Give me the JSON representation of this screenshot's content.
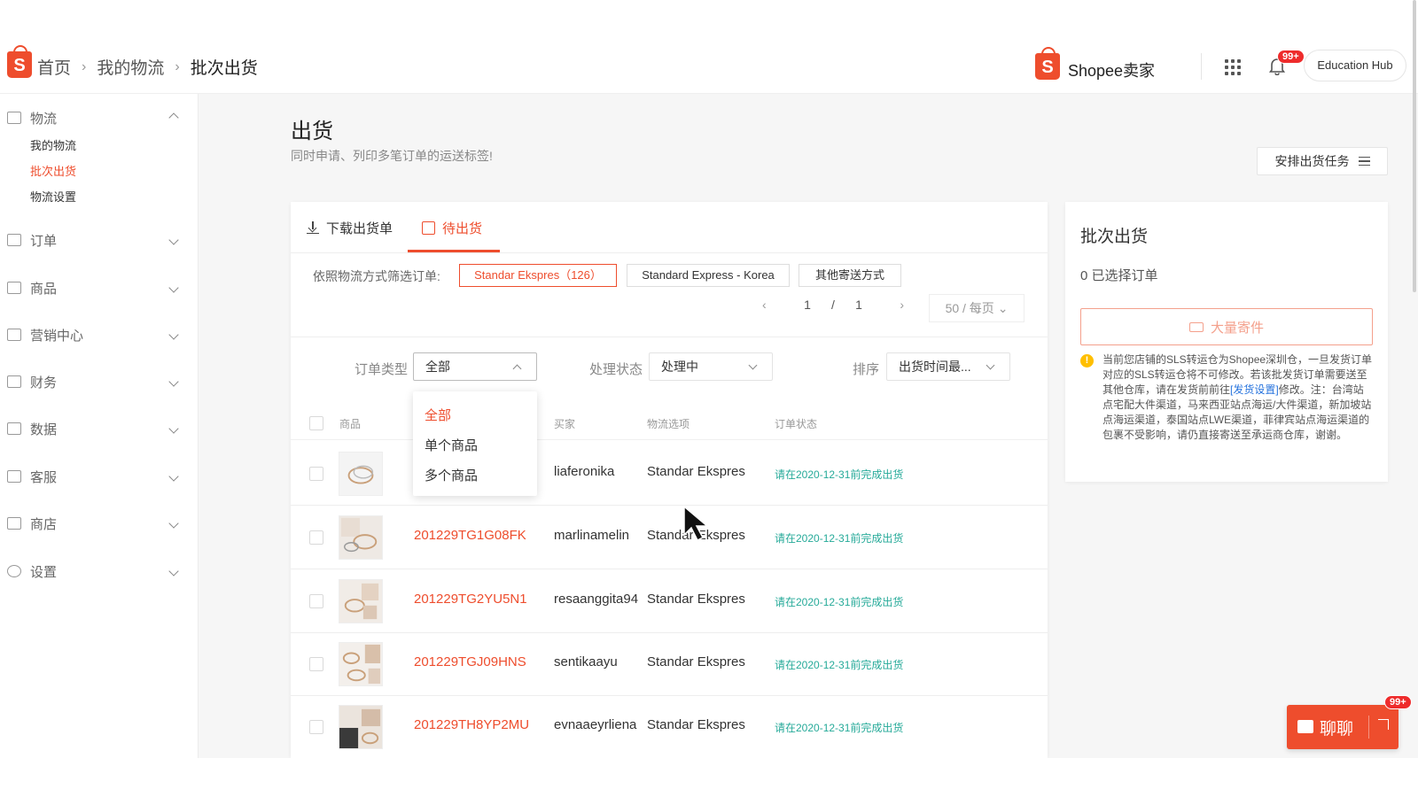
{
  "header": {
    "breadcrumb": [
      "首页",
      "我的物流",
      "批次出货"
    ],
    "brand": "Shopee卖家",
    "notifications_badge": "99+",
    "education_hub": "Education Hub"
  },
  "sidebar": {
    "groups": [
      {
        "label": "物流",
        "icon": "truck-icon",
        "expanded": true,
        "items": [
          "我的物流",
          "批次出货",
          "物流设置"
        ],
        "active_item": "批次出货"
      },
      {
        "label": "订单",
        "icon": "clipboard-icon"
      },
      {
        "label": "商品",
        "icon": "box-icon"
      },
      {
        "label": "营销中心",
        "icon": "tag-icon"
      },
      {
        "label": "财务",
        "icon": "wallet-icon"
      },
      {
        "label": "数据",
        "icon": "chart-icon"
      },
      {
        "label": "客服",
        "icon": "chat-icon"
      },
      {
        "label": "商店",
        "icon": "shop-icon"
      },
      {
        "label": "设置",
        "icon": "gear-icon"
      }
    ]
  },
  "page": {
    "title": "出货",
    "subtitle": "同时申请、列印多笔订单的运送标签!",
    "arrange_button": "安排出货任务"
  },
  "tabs": [
    {
      "label": "下载出货单",
      "icon": "download-icon"
    },
    {
      "label": "待出货",
      "icon": "package-icon",
      "active": true
    }
  ],
  "filter": {
    "label": "依照物流方式筛选订单:",
    "chips": [
      "Standar Ekspres（126）",
      "Standard Express - Korea",
      "其他寄送方式"
    ],
    "active_chip": 0
  },
  "pagination": {
    "current": "1",
    "separator": "/",
    "total": "1",
    "per_page": "50 / 每页"
  },
  "filters": {
    "order_type": {
      "label": "订单类型",
      "value": "全部",
      "options": [
        "全部",
        "单个商品",
        "多个商品"
      ]
    },
    "process_status": {
      "label": "处理状态",
      "value": "处理中"
    },
    "sort": {
      "label": "排序",
      "value": "出货时间最..."
    }
  },
  "table": {
    "headers": [
      "商品",
      "买家",
      "物流选项",
      "订单状态"
    ],
    "rows": [
      {
        "order_id": "",
        "buyer": "liaferonika",
        "shipping": "Standar Ekspres",
        "status": "请在2020-12-31前完成出货"
      },
      {
        "order_id": "201229TG1G08FK",
        "buyer": "marlinamelin",
        "shipping": "Standar Ekspres",
        "status": "请在2020-12-31前完成出货"
      },
      {
        "order_id": "201229TG2YU5N1",
        "buyer": "resaanggita94",
        "shipping": "Standar Ekspres",
        "status": "请在2020-12-31前完成出货"
      },
      {
        "order_id": "201229TGJ09HNS",
        "buyer": "sentikaayu",
        "shipping": "Standar Ekspres",
        "status": "请在2020-12-31前完成出货"
      },
      {
        "order_id": "201229TH8YP2MU",
        "buyer": "evnaaeyrliena",
        "shipping": "Standar Ekspres",
        "status": "请在2020-12-31前完成出货"
      }
    ]
  },
  "batch_panel": {
    "title": "批次出货",
    "selected_count": "0 已选择订单",
    "bulk_button": "大量寄件",
    "note_part1": "当前您店铺的SLS转运仓为Shopee深圳仓，一旦发货订单对应的SLS转运仓将不可修改。若该批发货订单需要送至其他仓库，请在发货前前往",
    "note_link": "[发货设置]",
    "note_part2": "修改。注：台湾站点宅配大件渠道，马来西亚站点海运/大件渠道，新加坡站点海运渠道，泰国站点LWE渠道，菲律宾站点海运渠道的包裹不受影响，请仍直接寄送至承运商仓库，谢谢。"
  },
  "chat": {
    "label": "聊聊",
    "badge": "99+"
  },
  "colors": {
    "brand": "#ee4d2d",
    "status": "#26aa99",
    "link": "#2673dd",
    "warning": "#ffbf00"
  }
}
